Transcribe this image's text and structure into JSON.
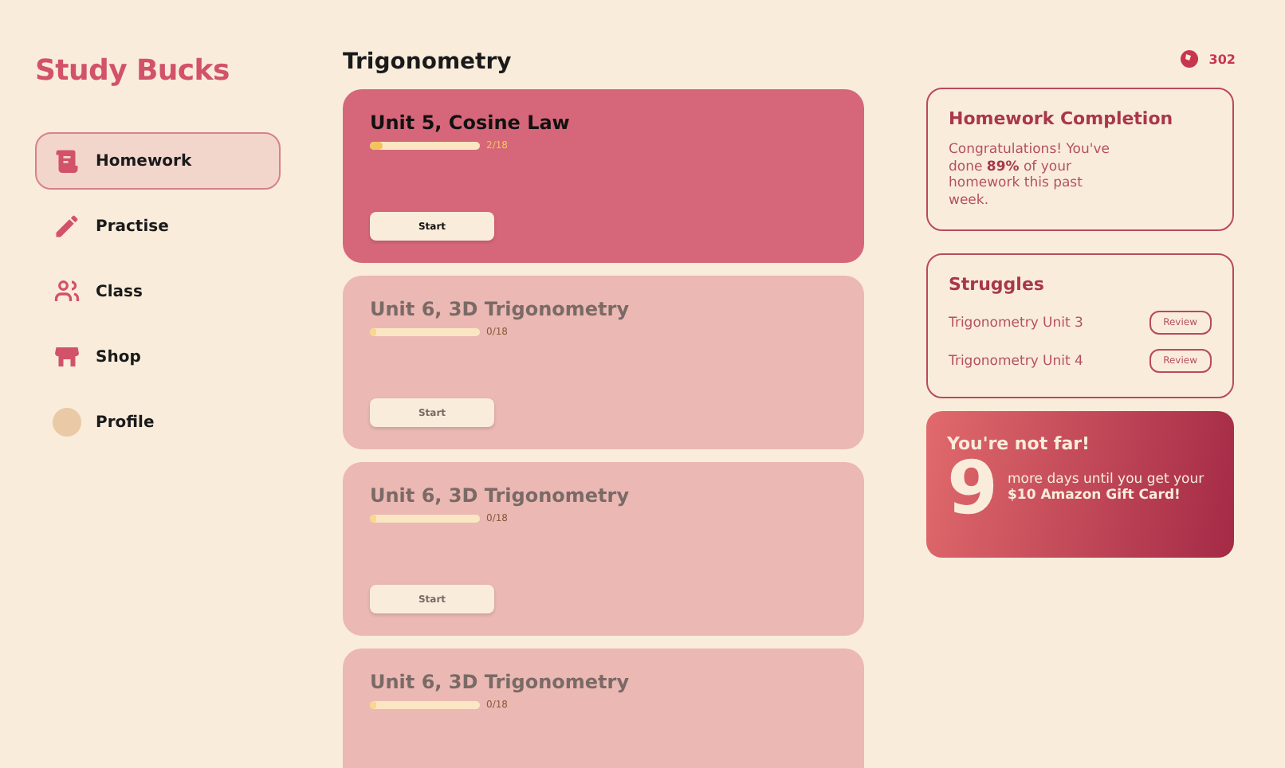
{
  "app": {
    "title": "Study Bucks"
  },
  "sidebar": {
    "items": [
      {
        "label": "Homework",
        "kind": "scroll",
        "selected": true
      },
      {
        "label": "Practise",
        "kind": "pencil",
        "selected": false
      },
      {
        "label": "Class",
        "kind": "people",
        "selected": false
      },
      {
        "label": "Shop",
        "kind": "store",
        "selected": false
      },
      {
        "label": "Profile",
        "kind": "avatar",
        "selected": false
      }
    ]
  },
  "main": {
    "title": "Trigonometry",
    "units": [
      {
        "title": "Unit 5, Cosine Law",
        "progress": "2/18",
        "level": 0.11,
        "button": "Start",
        "locked": false
      },
      {
        "title": "Unit 6, 3D Trigonometry",
        "progress": "0/18",
        "level": 0.06,
        "button": "Start",
        "locked": true
      },
      {
        "title": "Unit 6, 3D Trigonometry",
        "progress": "0/18",
        "level": 0.06,
        "button": "Start",
        "locked": true
      },
      {
        "title": "Unit 6, 3D Trigonometry",
        "progress": "0/18",
        "level": 0.06,
        "locked": true
      }
    ]
  },
  "balance": "302",
  "completion": {
    "title": "Homework Completion",
    "text": "Congratulations! You've done **89%** of your homework this past week."
  },
  "struggles": {
    "title": "Struggles",
    "items": [
      {
        "label": "Trigonometry Unit 3",
        "button": "Review"
      },
      {
        "label": "Trigonometry Unit 4",
        "button": "Review"
      }
    ]
  },
  "reward": {
    "title": "You're not far!",
    "number": "9",
    "text": "more days until you get your",
    "prize": "$10 Amazon Gift Card!"
  }
}
